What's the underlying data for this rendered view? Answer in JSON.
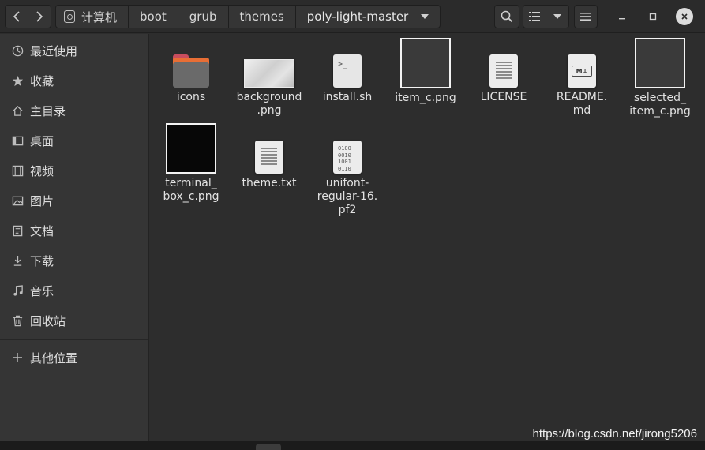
{
  "header": {
    "breadcrumbs": [
      {
        "label": "计算机",
        "icon": "disk-icon"
      },
      {
        "label": "boot"
      },
      {
        "label": "grub"
      },
      {
        "label": "themes"
      },
      {
        "label": "poly-light-master",
        "current": true
      }
    ],
    "buttons": [
      "back",
      "forward",
      "search",
      "list-view",
      "view-options",
      "menu",
      "minimize",
      "maximize",
      "close"
    ]
  },
  "sidebar": {
    "items": [
      {
        "label": "最近使用",
        "icon": "clock-icon"
      },
      {
        "label": "收藏",
        "icon": "star-icon"
      },
      {
        "label": "主目录",
        "icon": "home-icon"
      },
      {
        "label": "桌面",
        "icon": "desktop-icon"
      },
      {
        "label": "视频",
        "icon": "video-icon"
      },
      {
        "label": "图片",
        "icon": "picture-icon"
      },
      {
        "label": "文档",
        "icon": "document-icon"
      },
      {
        "label": "下载",
        "icon": "download-icon"
      },
      {
        "label": "音乐",
        "icon": "music-icon"
      },
      {
        "label": "回收站",
        "icon": "trash-icon"
      },
      {
        "label": "其他位置",
        "icon": "plus-icon"
      }
    ]
  },
  "files": [
    {
      "name": "icons",
      "kind": "folder"
    },
    {
      "name": "background\n.png",
      "kind": "image-bg"
    },
    {
      "name": "install.sh",
      "kind": "script"
    },
    {
      "name": "item_c.png",
      "kind": "image-dark"
    },
    {
      "name": "LICENSE",
      "kind": "text"
    },
    {
      "name": "README.\nmd",
      "kind": "markdown"
    },
    {
      "name": "selected_\nitem_c.png",
      "kind": "image-dark"
    },
    {
      "name": "terminal_\nbox_c.png",
      "kind": "image-black"
    },
    {
      "name": "theme.txt",
      "kind": "text"
    },
    {
      "name": "unifont-\nregular-16.\npf2",
      "kind": "binary"
    }
  ],
  "icons": {
    "script_glyph": ">_",
    "markdown_glyph": "M↓",
    "binary_glyph": "0100\n0010\n1001\n0110"
  },
  "watermark": "https://blog.csdn.net/jirong5206",
  "colors": {
    "background": "#2d2d2d",
    "sidebar": "#353535",
    "folder_accent": "#e86e35"
  }
}
